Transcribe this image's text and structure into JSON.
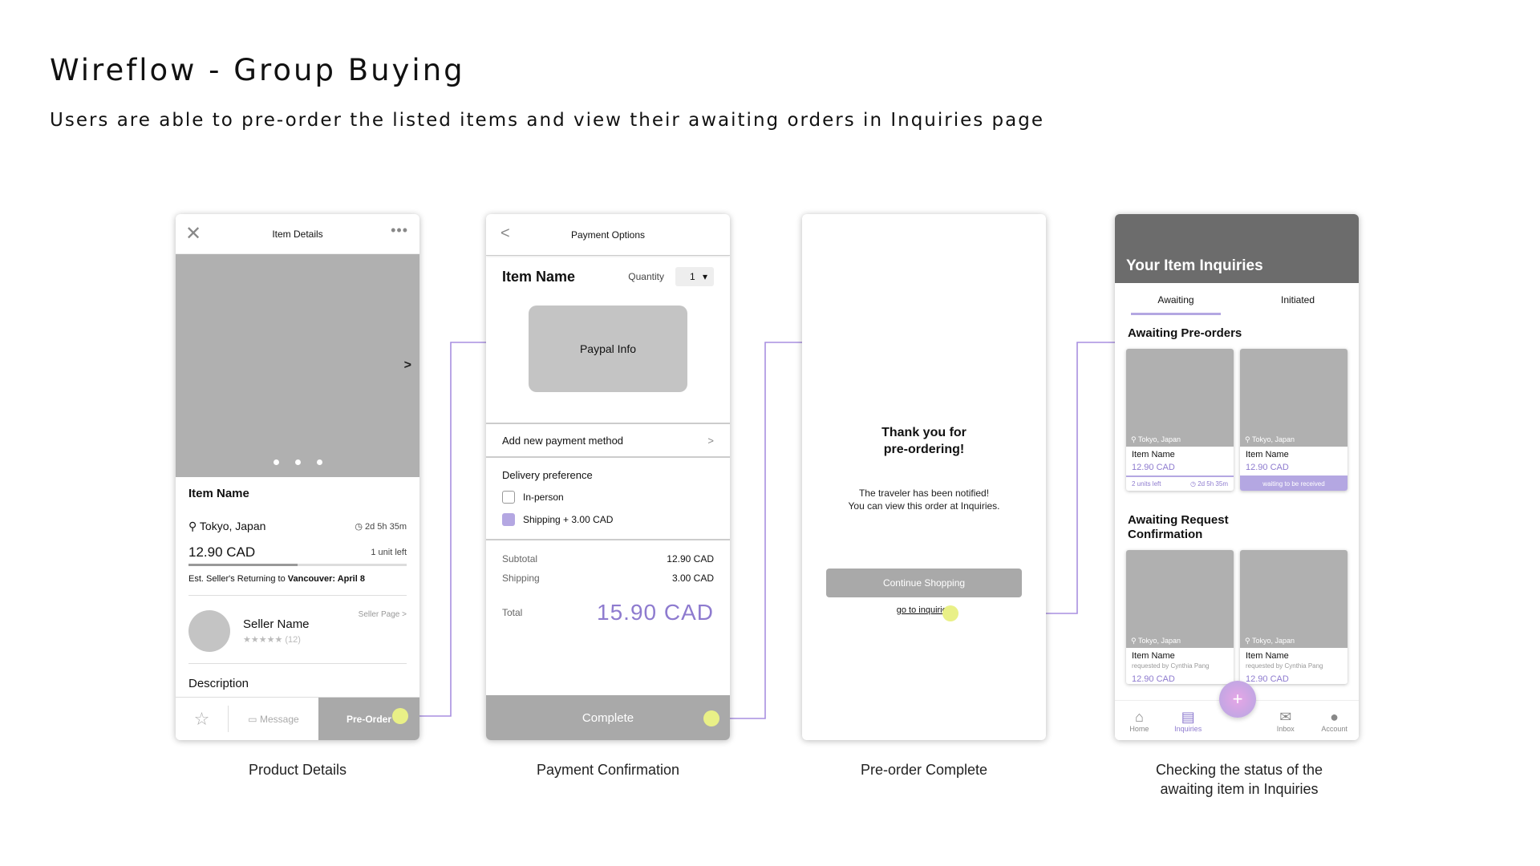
{
  "page": {
    "title": "Wireflow - Group Buying",
    "subtitle": "Users are able to pre-order the listed items and view their awaiting orders in Inquiries page"
  },
  "colors": {
    "accent": "#b4a7e2",
    "accent_text": "#8e7bcf",
    "placeholder": "#b0b0b0",
    "touch": "#e9f087"
  },
  "screens": {
    "product": {
      "caption": "Product Details",
      "header_title": "Item Details",
      "close_icon": "✕",
      "more_icon": "•••",
      "next_icon": ">",
      "item_name": "Item Name",
      "location": "Tokyo, Japan",
      "time_left": "2d 5h 35m",
      "price": "12.90 CAD",
      "units_left": "1 unit left",
      "progress": 0.5,
      "est_label": "Est. Seller's Returning to",
      "est_value": "Vancouver: April 8",
      "seller_name": "Seller Name",
      "seller_page": "Seller Page >",
      "rating_count": "(12)",
      "description_label": "Description",
      "message_label": "Message",
      "preorder_label": "Pre-Order"
    },
    "payment": {
      "caption": "Payment Confirmation",
      "header_title": "Payment Options",
      "item_name": "Item Name",
      "quantity_label": "Quantity",
      "quantity_value": "1",
      "paypal_label": "Paypal Info",
      "add_payment": "Add new payment method",
      "delivery_label": "Delivery preference",
      "option_inperson": "In-person",
      "option_shipping": "Shipping + 3.00 CAD",
      "subtotal_label": "Subtotal",
      "subtotal_value": "12.90 CAD",
      "shipping_label": "Shipping",
      "shipping_value": "3.00 CAD",
      "total_label": "Total",
      "total_value": "15.90 CAD",
      "complete_label": "Complete"
    },
    "complete": {
      "caption": "Pre-order Complete",
      "thanks_line1": "Thank you for",
      "thanks_line2": "pre-ordering!",
      "info_line1": "The traveler has been notified!",
      "info_line2": "You can view this order at Inquiries.",
      "continue_label": "Continue Shopping",
      "link_label": "go to inquiries"
    },
    "inquiries": {
      "caption_line1": "Checking the status of the",
      "caption_line2": "awaiting item in Inquiries",
      "header_title": "Your Item Inquiries",
      "tabs": [
        "Awaiting",
        "Initiated"
      ],
      "section1": "Awaiting Pre-orders",
      "section2_line1": "Awaiting Request",
      "section2_line2": "Confirmation",
      "cards_top": [
        {
          "location": "Tokyo, Japan",
          "name": "Item Name",
          "price": "12.90 CAD",
          "units": "2 units left",
          "time": "2d 5h 35m"
        },
        {
          "location": "Tokyo, Japan",
          "name": "Item Name",
          "price": "12.90 CAD",
          "status": "waiting to be received"
        }
      ],
      "cards_bottom": [
        {
          "location": "Tokyo, Japan",
          "name": "Item Name",
          "requested": "requested by Cynthia Pang",
          "price": "12.90 CAD"
        },
        {
          "location": "Tokyo, Japan",
          "name": "Item Name",
          "requested": "requested by Cynthia Pang",
          "price": "12.90 CAD"
        }
      ],
      "nav": [
        "Home",
        "Inquiries",
        "Inbox",
        "Account"
      ],
      "fab_icon": "+"
    }
  }
}
